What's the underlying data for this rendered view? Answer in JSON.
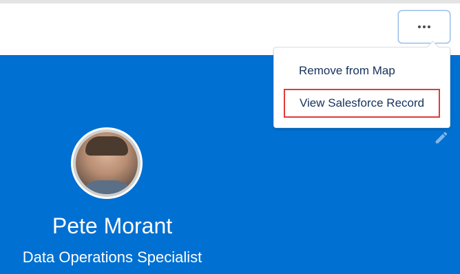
{
  "header": {
    "actions_icon": "more-actions-icon"
  },
  "actions_menu": {
    "items": [
      {
        "label": "Remove from Map"
      },
      {
        "label": "View Salesforce Record",
        "highlighted": true
      }
    ]
  },
  "profile": {
    "name": "Pete Morant",
    "title": "Data Operations Specialist",
    "edit_icon": "pencil-icon"
  },
  "colors": {
    "hero_background": "#0070d2",
    "highlight_border": "#e03a3a",
    "menu_text": "#16325c"
  }
}
